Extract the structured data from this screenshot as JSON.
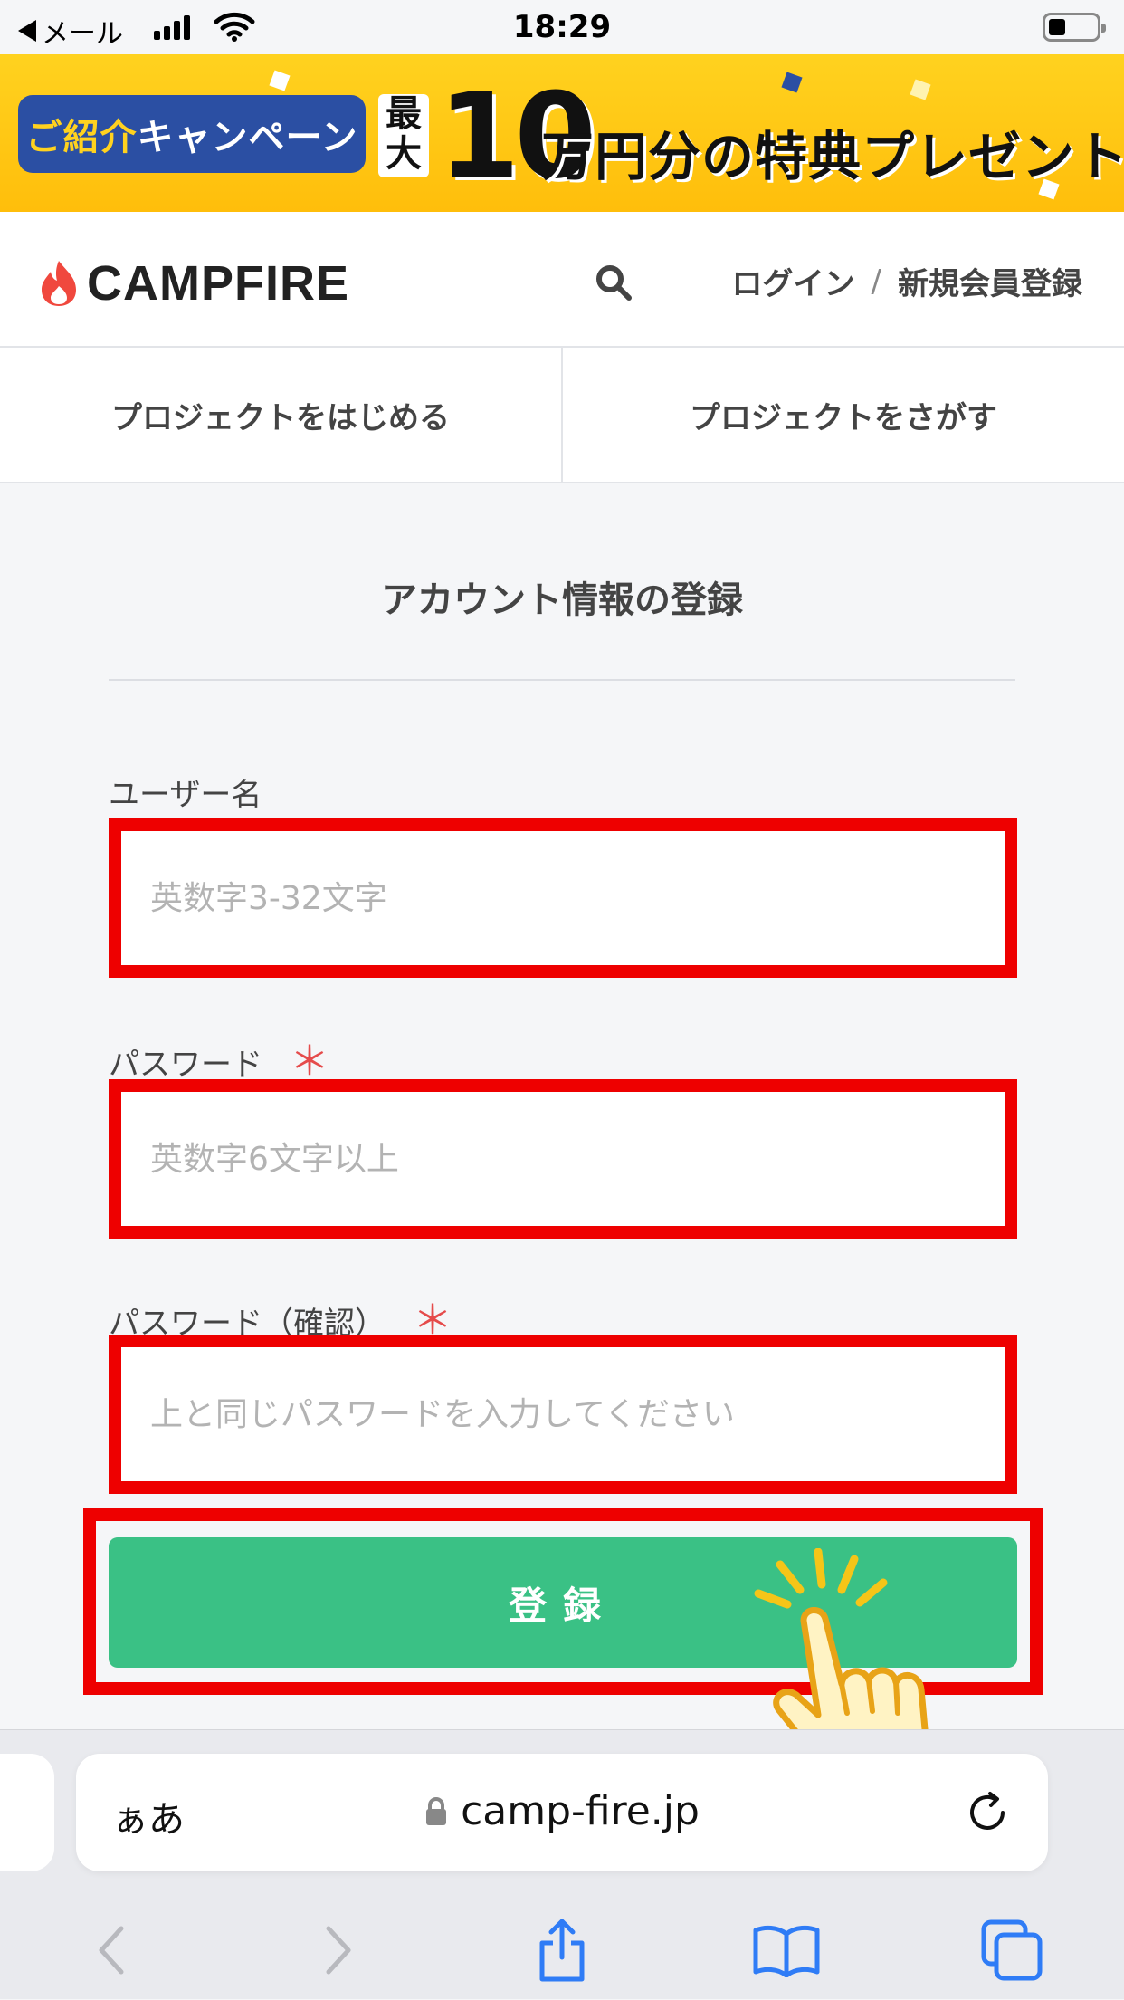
{
  "status_bar": {
    "back_label": "メール",
    "time": "18:29"
  },
  "banner": {
    "campaign_prefix": "ご紹介",
    "campaign_suffix": "キャンペーン",
    "max_label": "最大",
    "amount": "10",
    "rest": "万円分の特典プレゼント"
  },
  "header": {
    "logo_text": "CAMPFIRE",
    "login": "ログイン",
    "separator": "/",
    "signup": "新規会員登録"
  },
  "tabs": [
    {
      "label": "プロジェクトをはじめる"
    },
    {
      "label": "プロジェクトをさがす"
    }
  ],
  "form": {
    "title": "アカウント情報の登録",
    "username": {
      "label": "ユーザー名",
      "placeholder": "英数字3-32文字",
      "value": ""
    },
    "password": {
      "label": "パスワード",
      "required": "＊",
      "placeholder": "英数字6文字以上",
      "value": ""
    },
    "password_confirm": {
      "label": "パスワード（確認）",
      "required": "＊",
      "placeholder": "上と同じパスワードを入力してください",
      "value": ""
    },
    "submit_label": "登録"
  },
  "browser": {
    "aa_label": "ぁあ",
    "url": "camp-fire.jp"
  },
  "colors": {
    "accent_green": "#3ac185",
    "highlight_red": "#ee0000",
    "banner_yellow": "#ffc60f",
    "required_red": "#e54b4b",
    "ios_blue": "#2f7cf6"
  },
  "icons": [
    "back-arrow-icon",
    "signal-icon",
    "wifi-icon",
    "battery-icon",
    "flame-logo-icon",
    "search-icon",
    "lock-icon",
    "reload-icon",
    "back-icon",
    "forward-icon",
    "share-icon",
    "bookmarks-icon",
    "tabs-icon",
    "pointing-hand-icon"
  ]
}
